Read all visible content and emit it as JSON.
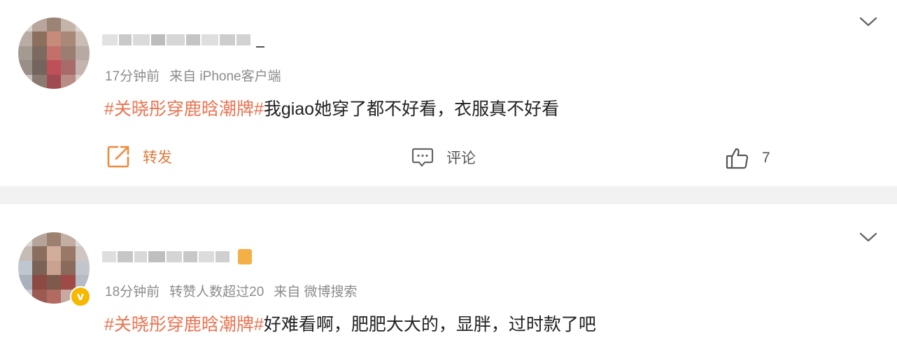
{
  "colors": {
    "topic": "#eb7350",
    "repost": "#f08a3c",
    "meta": "#8c8c8c",
    "badge": "#f6b800"
  },
  "comments": [
    {
      "time": "17分钟前",
      "source": "来自 iPhone客户端",
      "topic": "#关晓彤穿鹿晗潮牌#",
      "text": "我giao她穿了都不好看，衣服真不好看",
      "actions": {
        "repost": "转发",
        "comment": "评论",
        "likes": "7"
      }
    },
    {
      "time": "18分钟前",
      "source": "转赞人数超过20",
      "source2": "来自 微博搜索",
      "topic": "#关晓彤穿鹿晗潮牌#",
      "text": "好难看啊，肥肥大大的，显胖，过时款了吧"
    }
  ]
}
